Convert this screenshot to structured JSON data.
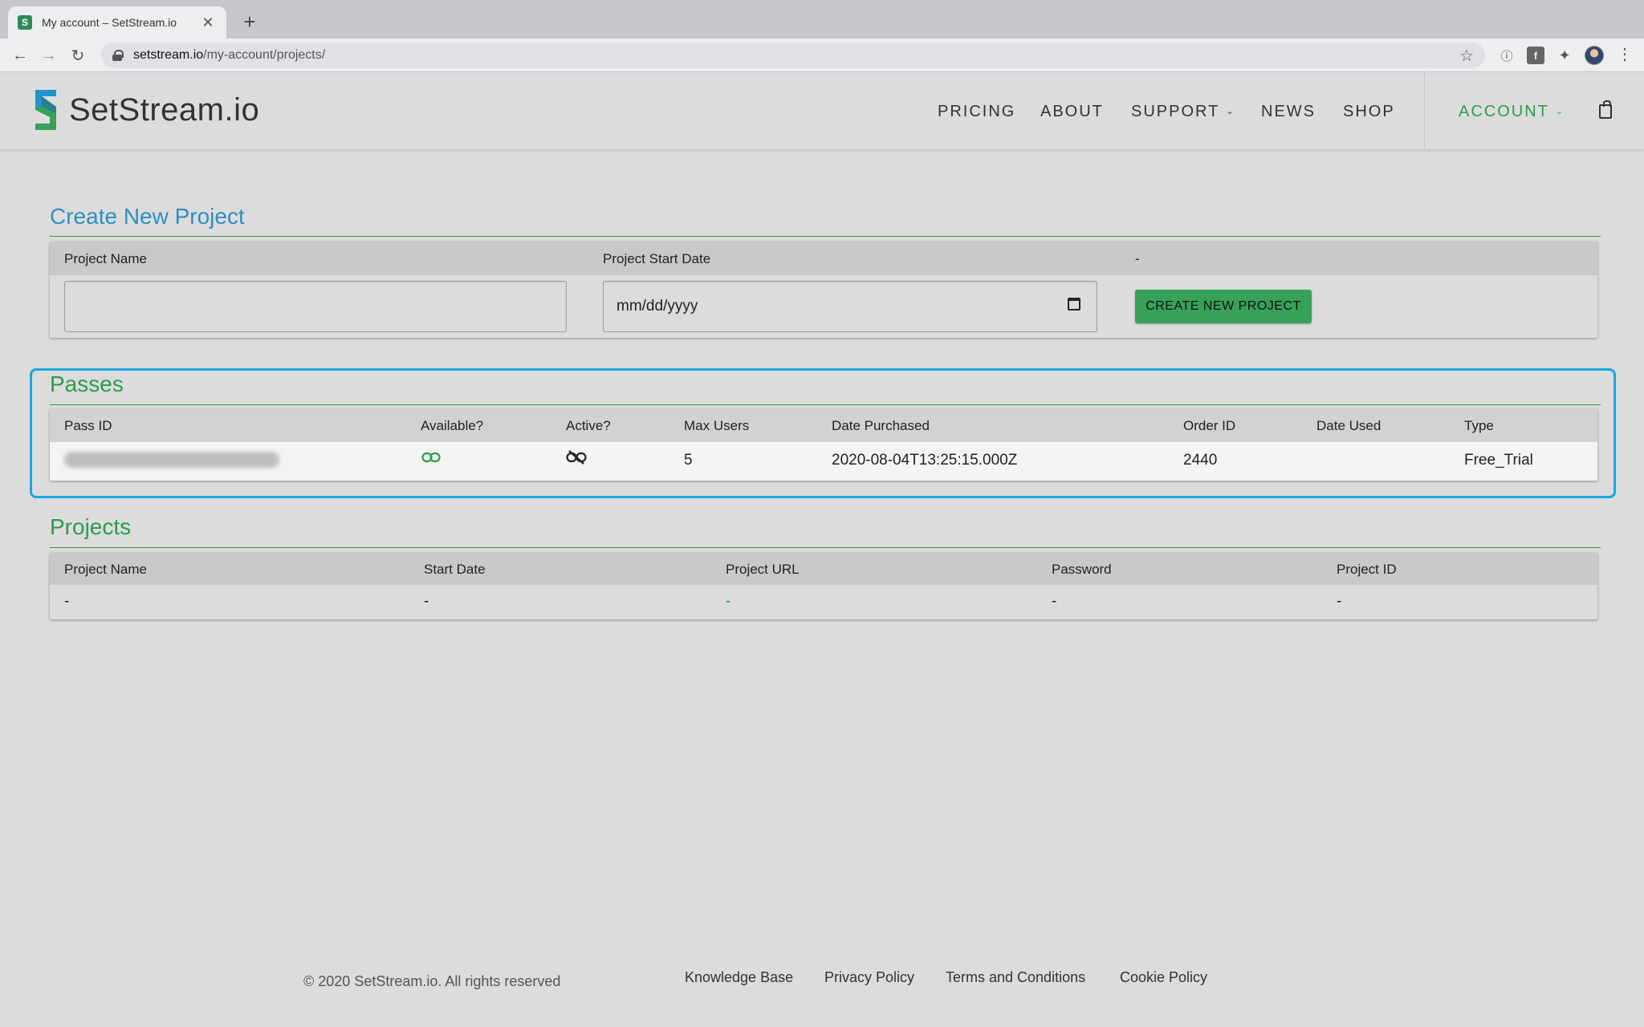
{
  "browser": {
    "tab_title": "My account – SetStream.io",
    "tab_favicon": "S",
    "url_host": "setstream.io",
    "url_path": "/my-account/projects/"
  },
  "header": {
    "logo_text": "SetStream.io",
    "nav": {
      "pricing": "PRICING",
      "about": "ABOUT",
      "support": "SUPPORT",
      "news": "NEWS",
      "shop": "SHOP",
      "account": "ACCOUNT"
    }
  },
  "create_project": {
    "title": "Create New Project",
    "col_name": "Project Name",
    "col_start": "Project Start Date",
    "col_action": "-",
    "name_value": "",
    "date_placeholder": "mm/dd/yyyy",
    "button_label": "CREATE NEW PROJECT"
  },
  "passes": {
    "title": "Passes",
    "columns": [
      "Pass ID",
      "Available?",
      "Active?",
      "Max Users",
      "Date Purchased",
      "Order ID",
      "Date Used",
      "Type"
    ],
    "rows": [
      {
        "available_icon": "link-icon",
        "active_icon": "link-off-icon",
        "max_users": "5",
        "date_purchased": "2020-08-04T13:25:15.000Z",
        "order_id": "2440",
        "date_used": "",
        "type": "Free_Trial"
      }
    ]
  },
  "projects": {
    "title": "Projects",
    "columns": [
      "Project Name",
      "Start Date",
      "Project URL",
      "Password",
      "Project ID"
    ],
    "rows": [
      {
        "name": "-",
        "start": "-",
        "url": "-",
        "password": "-",
        "id": "-"
      }
    ]
  },
  "footer": {
    "copyright": "© 2020 SetStream.io. All rights reserved",
    "links": [
      "Knowledge Base",
      "Privacy Policy",
      "Terms and Conditions",
      "Cookie Policy"
    ]
  },
  "colors": {
    "brand_green": "#2e9b4d",
    "title_blue": "#2f8fc1",
    "highlight": "#19a7de"
  }
}
